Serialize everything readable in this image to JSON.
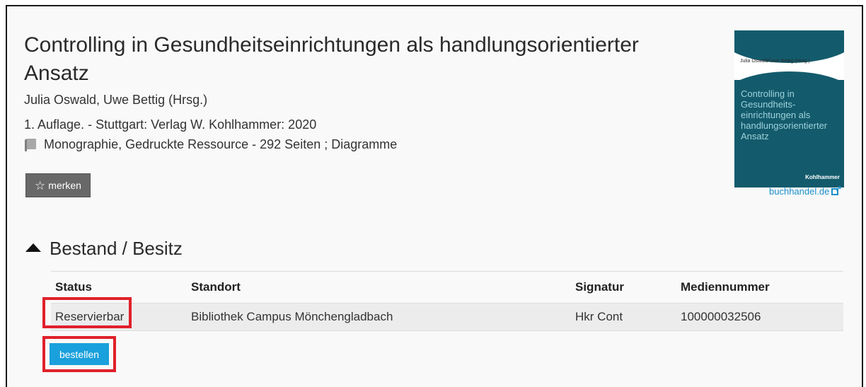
{
  "record": {
    "title": "Controlling in Gesundheitseinrichtungen als handlungsorientierter Ansatz",
    "authors": "Julia Oswald, Uwe Bettig (Hrsg.)",
    "edition": "1. Auflage. - Stuttgart: Verlag W. Kohlhammer: 2020",
    "format": "Monographie, Gedruckte Ressource - 292 Seiten ; Diagramme",
    "format_icon": "book-icon",
    "merken_label": "merken",
    "merken_icon": "star-outline-icon"
  },
  "cover": {
    "authors": "Julia Oswald/Uwe Bettig (Hrsg.)",
    "title": "Controlling in Gesundheits-einrichtungen als handlungsorientierter Ansatz",
    "publisher": "Kohlhammer",
    "color": "#135b6c"
  },
  "buchhandel": {
    "label": "buchhandel.de",
    "icon": "external-link-icon"
  },
  "holdings": {
    "section_title": "Bestand / Besitz",
    "toggle_icon": "chevron-up-icon",
    "columns": [
      "Status",
      "Standort",
      "Signatur",
      "Mediennummer"
    ],
    "rows": [
      {
        "status": "Reservierbar",
        "location": "Bibliothek Campus Mönchengladbach",
        "signature": "Hkr Cont",
        "media_number": "100000032506"
      }
    ],
    "order_label": "bestellen"
  },
  "colors": {
    "accent": "#1aa0dc",
    "highlight": "#e0202a",
    "button_gray": "#686868"
  }
}
